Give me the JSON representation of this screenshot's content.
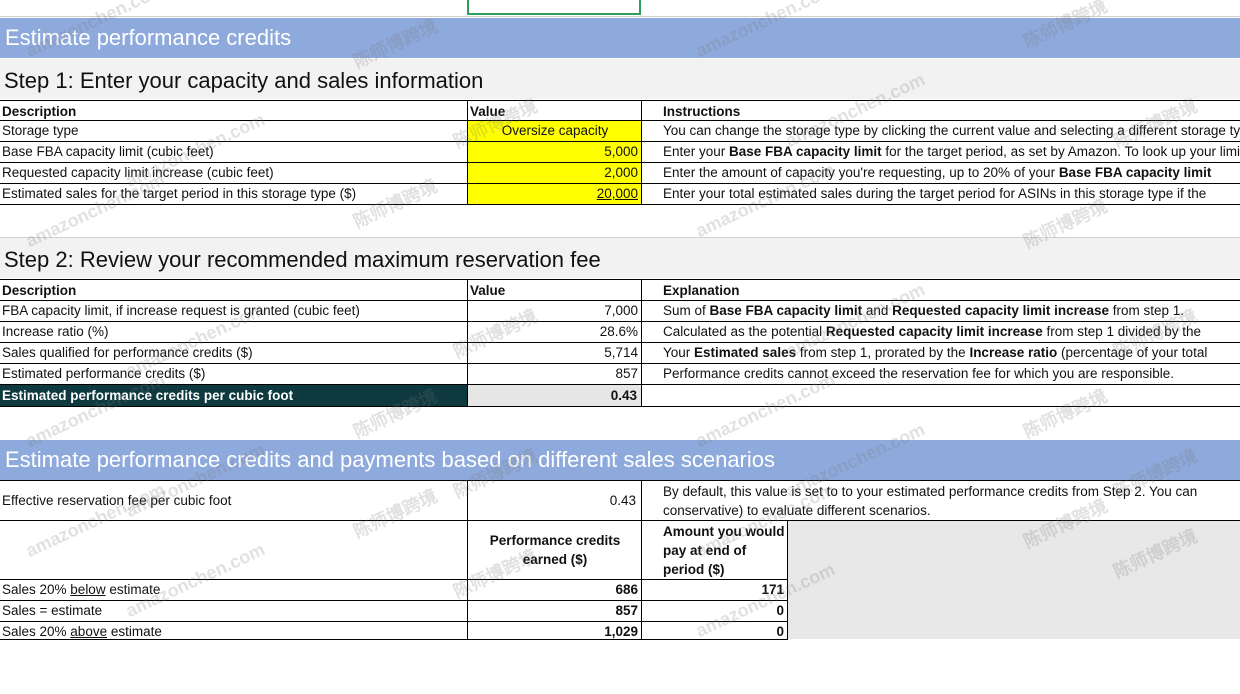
{
  "colors": {
    "banner": "#8ea9db",
    "input_fill": "#ffff00",
    "highlight_row": "#0e3a3f",
    "grey_cell": "#e6e6e6",
    "selection": "#2e9e5b"
  },
  "banner1": "Estimate performance credits",
  "step1": {
    "title": "Step 1: Enter your capacity and sales information",
    "headers": {
      "description": "Description",
      "value": "Value",
      "instructions": "Instructions"
    },
    "rows": [
      {
        "description": "Storage type",
        "value": "Oversize capacity",
        "instruction": [
          {
            "t": "You can change the storage type by clicking the current value and selecting a different storage type."
          }
        ]
      },
      {
        "description": "Base FBA capacity limit (cubic feet)",
        "value": "5,000",
        "instruction": [
          {
            "t": "Enter your "
          },
          {
            "t": "Base FBA capacity limit",
            "b": true
          },
          {
            "t": " for the target period, as set by Amazon. To look up your limit"
          }
        ]
      },
      {
        "description": "Requested capacity limit increase (cubic feet)",
        "value": "2,000",
        "instruction": [
          {
            "t": "Enter the amount of capacity you're requesting, up to 20% of your "
          },
          {
            "t": "Base FBA capacity limit",
            "b": true
          }
        ]
      },
      {
        "description": "Estimated sales for the target period in this storage type ($)",
        "value": "20,000",
        "instruction": [
          {
            "t": "Enter your total estimated sales during the target period for ASINs in this storage type if the"
          }
        ]
      }
    ]
  },
  "step2": {
    "title": "Step 2: Review your recommended maximum reservation fee",
    "headers": {
      "description": "Description",
      "value": "Value",
      "explanation": "Explanation"
    },
    "rows": [
      {
        "description": "FBA capacity limit, if increase request is granted (cubic feet)",
        "value": "7,000",
        "explanation": [
          {
            "t": "Sum of "
          },
          {
            "t": "Base FBA capacity limit",
            "b": true
          },
          {
            "t": " and "
          },
          {
            "t": "Requested capacity limit increase",
            "b": true
          },
          {
            "t": " from step 1."
          }
        ]
      },
      {
        "description": "Increase ratio (%)",
        "value": "28.6%",
        "explanation": [
          {
            "t": "Calculated as the potential "
          },
          {
            "t": "Requested capacity limit increase",
            "b": true
          },
          {
            "t": " from step 1 divided by the"
          }
        ]
      },
      {
        "description": "Sales qualified for performance credits ($)",
        "value": "5,714",
        "explanation": [
          {
            "t": "Your "
          },
          {
            "t": "Estimated sales",
            "b": true
          },
          {
            "t": " from step 1, prorated by the "
          },
          {
            "t": "Increase ratio",
            "b": true
          },
          {
            "t": " (percentage of your total"
          }
        ]
      },
      {
        "description": "Estimated performance credits ($)",
        "value": "857",
        "explanation": [
          {
            "t": "Performance credits cannot exceed the reservation fee for which you are responsible."
          }
        ]
      }
    ],
    "highlight": {
      "description": "Estimated performance credits per cubic foot",
      "value": "0.43"
    }
  },
  "banner2": "Estimate performance credits and payments based on different sales scenarios",
  "scenarios": {
    "fee_label": "Effective reservation fee per cubic foot",
    "fee_value": "0.43",
    "fee_note_1": "By default, this value is set to to your estimated performance credits from Step 2. You can",
    "fee_note_2": "conservative) to evaluate different scenarios.",
    "col_credits": "Performance credits earned ($)",
    "col_pay": "Amount you would pay at end of period ($)",
    "rows": [
      {
        "label_pre": "Sales 20% ",
        "label_u": "below",
        "label_post": " estimate",
        "credits": "686",
        "pay": "171"
      },
      {
        "label_pre": "Sales = estimate",
        "label_u": "",
        "label_post": "",
        "credits": "857",
        "pay": "0"
      },
      {
        "label_pre": "Sales 20% ",
        "label_u": "above",
        "label_post": " estimate",
        "credits": "1,029",
        "pay": "0"
      }
    ]
  },
  "watermarks": [
    "amazonchen.com",
    "陈师博跨境"
  ]
}
